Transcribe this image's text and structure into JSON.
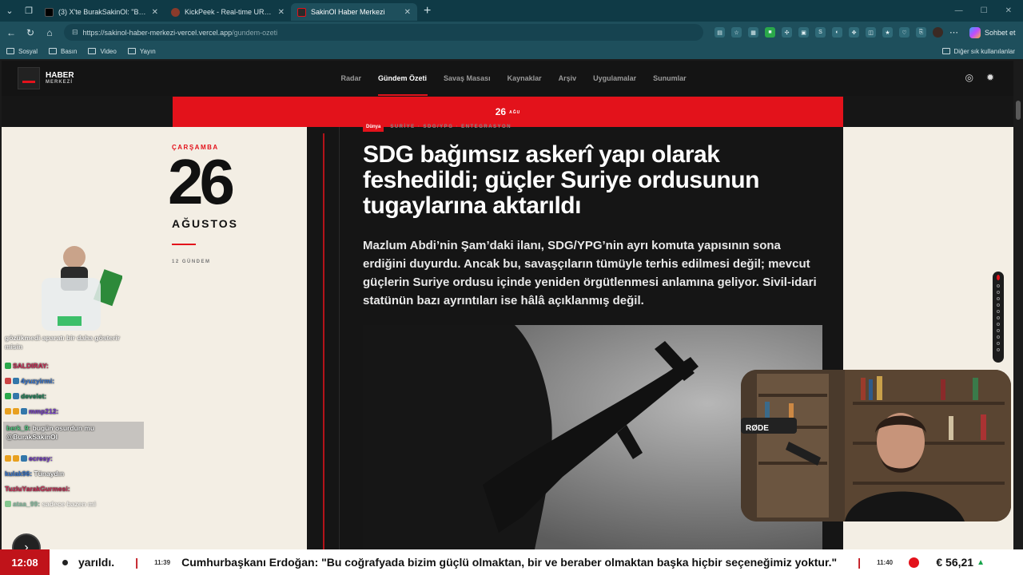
{
  "browser": {
    "tabs": [
      {
        "label": "(3) X'te BurakSakinOl: \"Bugün sade...",
        "active": false
      },
      {
        "label": "KickPeek - Real-time URL Crawler",
        "active": false
      },
      {
        "label": "SakinOl Haber Merkezi",
        "active": true
      }
    ],
    "url_host": "https://sakinol-haber-merkezi-vercel.vercel.app",
    "url_path": "/gundem-ozeti",
    "chat_button": "Sohbet et",
    "bookmarks": [
      "Sosyal",
      "Basın",
      "Video",
      "Yayın"
    ],
    "other_bookmarks": "Diğer sık kullanılanlar"
  },
  "site": {
    "logo_line1": "HABER",
    "logo_line2": "MERKEZİ",
    "nav": [
      "Radar",
      "Gündem Özeti",
      "Savaş Masası",
      "Kaynaklar",
      "Arşiv",
      "Uygulamalar",
      "Sunumlar"
    ],
    "active_nav": "Gündem Özeti"
  },
  "banner": {
    "day": "26",
    "month_short": "AĞU"
  },
  "date_panel": {
    "weekday": "ÇARŞAMBA",
    "day": "26",
    "month": "AĞUSTOS",
    "count": "12 GÜNDEM"
  },
  "article": {
    "category": "Dünya",
    "tag_path": "SURİYE · SDG/YPG · ENTEGRASYON",
    "headline": "SDG bağımsız askerî yapı olarak feshedildi; güçler Suriye ordusunun tugaylarına aktarıldı",
    "lede": "Mazlum Abdi’nin Şam’daki ilanı, SDG/YPG’nin ayrı komuta yapısının sona erdiğini duyurdu. Ancak bu, savaşçıların tümüyle terhis edilmesi değil; mevcut güçlerin Suriye ordusu içinde yeniden örgütlenmesi anlamına geliyor. Sivil-idari statünün bazı ayrıntıları ise hâlâ açıklanmış değil."
  },
  "chat": {
    "messages": [
      {
        "user": "",
        "text": "gözükmedi aparatı bir daha gösterir misin"
      },
      {
        "user": "SALDIRAY:",
        "text": ""
      },
      {
        "user": "4yuzyirmi:",
        "text": ""
      },
      {
        "user": "develet:",
        "text": ""
      },
      {
        "user": "mmp212:",
        "text": ""
      },
      {
        "user": "berk_9:",
        "text": "bugün osurdun mu @BurakSakinOl"
      },
      {
        "user": "ecresy:",
        "text": ""
      },
      {
        "user": "kulak96:",
        "text": "Tünaydın"
      },
      {
        "user": "TuzluYarakGurmesi:",
        "text": ""
      },
      {
        "user": "ataa_99:",
        "text": "sadece bazen mi"
      }
    ]
  },
  "ticker": {
    "clock": "12:08",
    "prev_fragment": "yarıldı.",
    "time1": "11:39",
    "headline": "Cumhurbaşkanı Erdoğan: \"Bu coğrafyada bizim güçlü olmaktan, bir ve beraber olmaktan başka hiçbir seçeneğimiz yoktur.\"",
    "time2": "11:40",
    "fx_value": "€ 56,21",
    "fx_trend": "▲"
  },
  "colors": {
    "accent_red": "#e3121b",
    "tab_bg": "#0f3a46",
    "address_bg": "#1e4f5c",
    "paper": "#f3eee4"
  }
}
